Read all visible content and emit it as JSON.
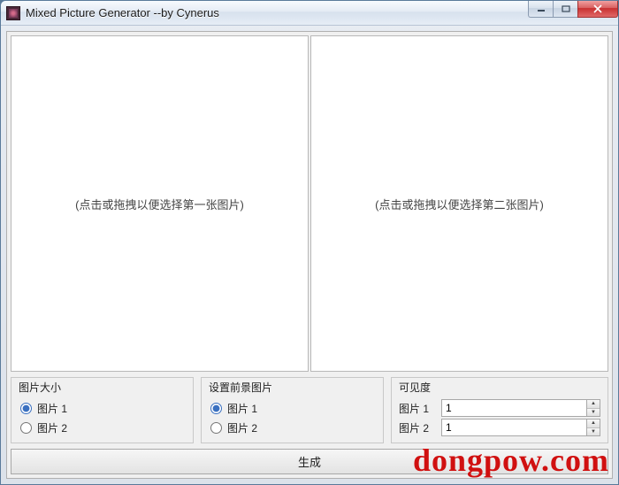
{
  "window": {
    "title": "Mixed Picture Generator    --by Cynerus"
  },
  "dropzones": {
    "first": "(点击或拖拽以便选择第一张图片)",
    "second": "(点击或拖拽以便选择第二张图片)"
  },
  "group_size": {
    "title": "图片大小",
    "opt1": "图片 1",
    "opt2": "图片 2",
    "selected": "opt1"
  },
  "group_foreground": {
    "title": "设置前景图片",
    "opt1": "图片 1",
    "opt2": "图片 2",
    "selected": "opt1"
  },
  "group_visibility": {
    "title": "可见度",
    "label1": "图片 1",
    "label2": "图片 2",
    "value1": "1",
    "value2": "1"
  },
  "buttons": {
    "generate": "生成"
  },
  "watermark": "dongpow.com"
}
